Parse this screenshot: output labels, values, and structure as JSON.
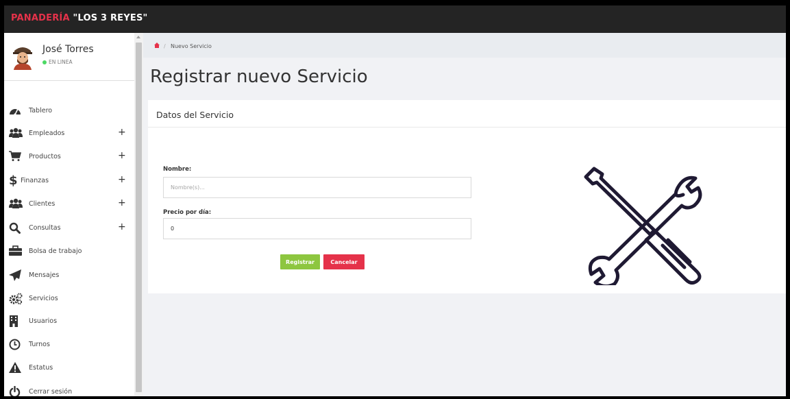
{
  "app": {
    "brand_part1": "PANADERÍA",
    "brand_part2": "\"LOS 3 REYES\""
  },
  "user": {
    "name": "José Torres",
    "status": "EN LINEA"
  },
  "sidebar": {
    "items": [
      {
        "label": "Tablero",
        "icon": "dashboard-icon",
        "has_submenu": false
      },
      {
        "label": "Empleados",
        "icon": "users-icon",
        "has_submenu": true
      },
      {
        "label": "Productos",
        "icon": "cart-icon",
        "has_submenu": true
      },
      {
        "label": "Finanzas",
        "icon": "dollar-icon",
        "has_submenu": true
      },
      {
        "label": "Clientes",
        "icon": "users-icon",
        "has_submenu": true
      },
      {
        "label": "Consultas",
        "icon": "search-icon",
        "has_submenu": true
      },
      {
        "label": "Bolsa de trabajo",
        "icon": "briefcase-icon",
        "has_submenu": false
      },
      {
        "label": "Mensajes",
        "icon": "paper-plane-icon",
        "has_submenu": false
      },
      {
        "label": "Servicios",
        "icon": "gears-icon",
        "has_submenu": false
      },
      {
        "label": "Usuarios",
        "icon": "building-icon",
        "has_submenu": false
      },
      {
        "label": "Turnos",
        "icon": "clock-icon",
        "has_submenu": false
      },
      {
        "label": "Estatus",
        "icon": "warning-icon",
        "has_submenu": false
      },
      {
        "label": "Cerrar sesión",
        "icon": "power-icon",
        "has_submenu": false
      }
    ],
    "plus_symbol": "+"
  },
  "breadcrumb": {
    "separator": "/",
    "current": "Nuevo Servicio"
  },
  "page": {
    "title": "Registrar nuevo Servicio"
  },
  "form": {
    "card_title": "Datos del Servicio",
    "name_label": "Nombre:",
    "name_placeholder": "Nombre(s)...",
    "name_value": "",
    "price_label": "Precio por día:",
    "price_value": "0",
    "submit_label": "Registrar",
    "cancel_label": "Cancelar"
  },
  "colors": {
    "brand_red": "#e5324a",
    "submit_green": "#8dc63f",
    "cancel_red": "#e5324a",
    "online_green": "#4cd964",
    "tools_icon": "#1f1a33"
  }
}
